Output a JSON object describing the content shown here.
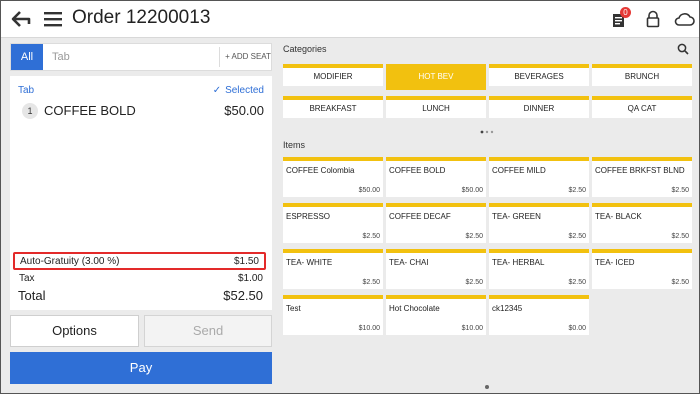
{
  "header": {
    "title": "Order 12200013",
    "notification_count": "0",
    "icons": [
      "back-arrow-icon",
      "menu-icon",
      "receipt-icon",
      "lock-icon",
      "cloud-icon"
    ]
  },
  "tabbar": {
    "all_label": "All",
    "tab_placeholder": "Tab",
    "add_seat_label": "+ ADD SEAT"
  },
  "order": {
    "tab_label": "Tab",
    "selected_label": "Selected",
    "items": [
      {
        "qty": "1",
        "name": "COFFEE BOLD",
        "price": "$50.00"
      }
    ],
    "auto_gratuity_label": "Auto-Gratuity (3.00 %)",
    "auto_gratuity_value": "$1.50",
    "tax_label": "Tax",
    "tax_value": "$1.00",
    "total_label": "Total",
    "total_value": "$52.50"
  },
  "actions": {
    "options_label": "Options",
    "send_label": "Send",
    "pay_label": "Pay"
  },
  "categories": {
    "title": "Categories",
    "selected": "HOT BEV",
    "list": [
      "MODIFIER",
      "HOT BEV",
      "BEVERAGES",
      "BRUNCH",
      "BREAKFAST",
      "LUNCH",
      "DINNER",
      "QA CAT"
    ]
  },
  "items": {
    "title": "Items",
    "list": [
      {
        "name": "COFFEE Colombia",
        "price": "$50.00"
      },
      {
        "name": "COFFEE BOLD",
        "price": "$50.00"
      },
      {
        "name": "COFFEE MILD",
        "price": "$2.50"
      },
      {
        "name": "COFFEE BRKFST BLND",
        "price": "$2.50"
      },
      {
        "name": "ESPRESSO",
        "price": "$2.50"
      },
      {
        "name": "COFFEE DECAF",
        "price": "$2.50"
      },
      {
        "name": "TEA- GREEN",
        "price": "$2.50"
      },
      {
        "name": "TEA- BLACK",
        "price": "$2.50"
      },
      {
        "name": "TEA- WHITE",
        "price": "$2.50"
      },
      {
        "name": "TEA- CHAI",
        "price": "$2.50"
      },
      {
        "name": "TEA- HERBAL",
        "price": "$2.50"
      },
      {
        "name": "TEA- ICED",
        "price": "$2.50"
      },
      {
        "name": "Test",
        "price": "$10.00"
      },
      {
        "name": "Hot Chocolate",
        "price": "$10.00"
      },
      {
        "name": "ck12345",
        "price": "$0.00"
      }
    ]
  },
  "colors": {
    "accent_blue": "#2f6fd6",
    "category_yellow": "#f2c10f",
    "highlight_red": "#e32a2a",
    "badge_red": "#e53935"
  }
}
